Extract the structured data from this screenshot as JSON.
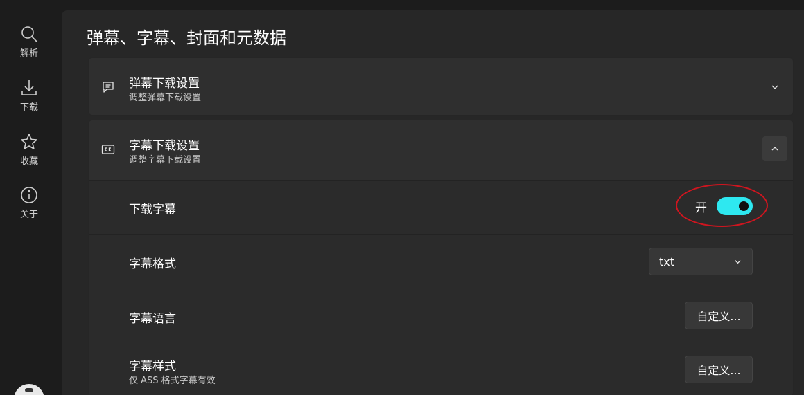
{
  "sidebar": {
    "items": [
      {
        "label": "解析",
        "icon": "search-icon"
      },
      {
        "label": "下载",
        "icon": "download-icon"
      },
      {
        "label": "收藏",
        "icon": "star-icon"
      },
      {
        "label": "关于",
        "icon": "info-icon"
      }
    ]
  },
  "page": {
    "title": "弹幕、字幕、封面和元数据"
  },
  "danmaku_card": {
    "title": "弹幕下载设置",
    "subtitle": "调整弹幕下载设置",
    "icon": "comment-icon",
    "expanded": false
  },
  "subtitle_card": {
    "title": "字幕下载设置",
    "subtitle": "调整字幕下载设置",
    "icon": "closed-caption-icon",
    "expanded": true,
    "rows": {
      "download": {
        "label": "下载字幕",
        "toggle_text": "开",
        "on": true
      },
      "format": {
        "label": "字幕格式",
        "value": "txt"
      },
      "language": {
        "label": "字幕语言",
        "button": "自定义..."
      },
      "style": {
        "label": "字幕样式",
        "sublabel": "仅 ASS 格式字幕有效",
        "button": "自定义..."
      }
    }
  },
  "colors": {
    "accent": "#2ee8f0",
    "highlight": "#d0151f",
    "background": "#1c1c1c",
    "panel": "#272727",
    "card": "#2f2f2f"
  }
}
